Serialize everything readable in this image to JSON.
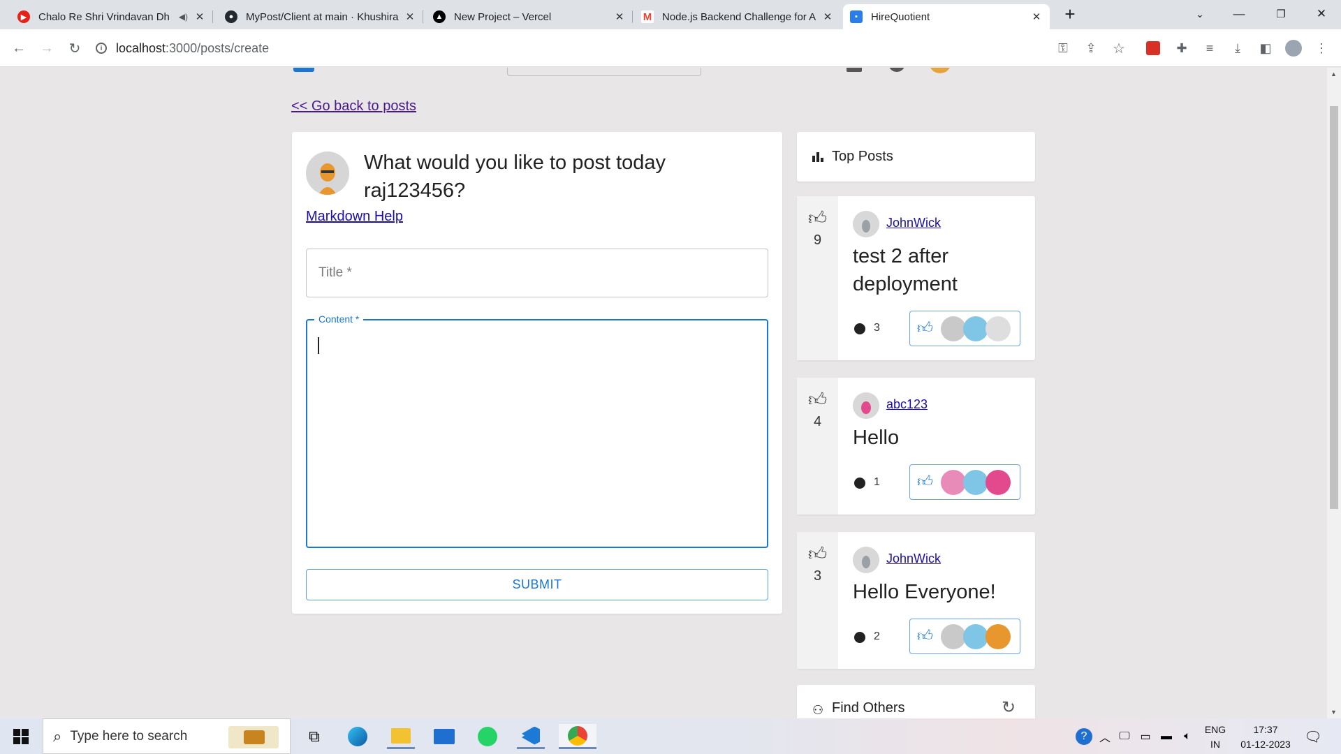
{
  "browser": {
    "tabs": [
      {
        "title": "Chalo Re Shri Vrindavan Dh",
        "favicon_color": "#e62117",
        "audio": "◀)"
      },
      {
        "title": "MyPost/Client at main · Khushira",
        "favicon_color": "#24292f"
      },
      {
        "title": "New Project – Vercel",
        "favicon_color": "#000000"
      },
      {
        "title": "Node.js Backend Challenge for A",
        "favicon_color": "#ea4335"
      },
      {
        "title": "HireQuotient",
        "favicon_color": "#2b7de9",
        "active": true
      }
    ],
    "url_host": "localhost",
    "url_path": ":3000/posts/create"
  },
  "page": {
    "back_link": "<< Go back to posts",
    "compose": {
      "heading": "What would you like to post today raj123456?",
      "markdown_help": "Markdown Help",
      "title_placeholder": "Title *",
      "content_label": "Content *",
      "submit_label": "SUBMIT"
    },
    "top_posts": {
      "heading": "Top Posts",
      "posts": [
        {
          "likes": "9",
          "author": "JohnWick",
          "title": "test 2 after deployment",
          "comments": "3"
        },
        {
          "likes": "4",
          "author": "abc123",
          "title": "Hello",
          "comments": "1"
        },
        {
          "likes": "3",
          "author": "JohnWick",
          "title": "Hello Everyone!",
          "comments": "2"
        }
      ]
    },
    "find_others": "Find Others"
  },
  "taskbar": {
    "search_placeholder": "Type here to search",
    "lang_top": "ENG",
    "lang_bottom": "IN",
    "time": "17:37",
    "date": "01-12-2023"
  },
  "colors": {
    "accent": "#1976d2",
    "page_bg": "#e8e6e6",
    "link": "#1a0dab"
  }
}
